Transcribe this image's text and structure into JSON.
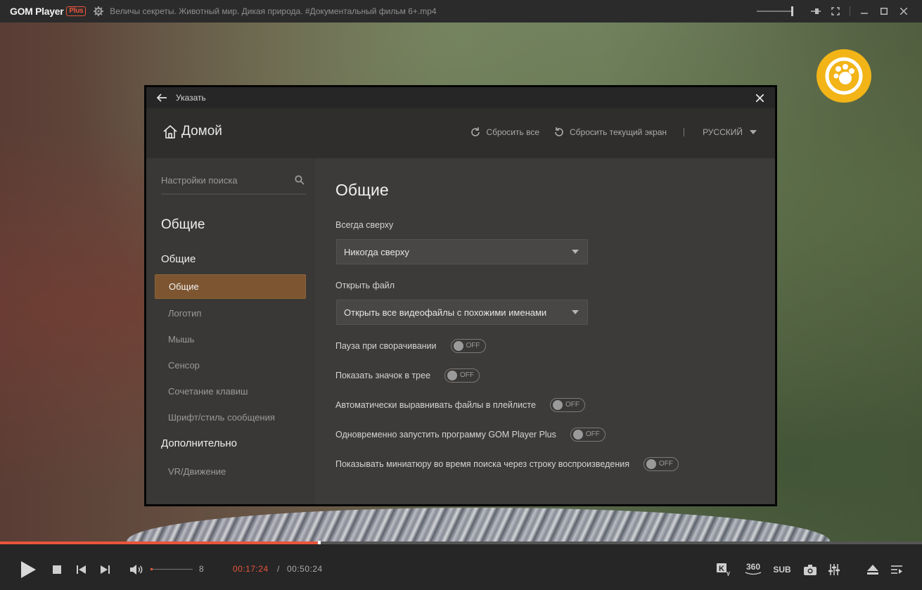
{
  "titlebar": {
    "app_name": "GOM Player",
    "app_badge": "Plus",
    "file_title": "Величы секреты. Животный мир. Дикая природа. #Документальный фильм 6+.mp4"
  },
  "dialog": {
    "header_title": "Указать",
    "home_label": "Домой",
    "reset_all": "Сбросить все",
    "reset_current": "Сбросить текущий экран",
    "language": "РУССКИЙ",
    "search_placeholder": "Настройки поиска",
    "sidebar": {
      "section_title": "Общие",
      "group1": "Общие",
      "items": [
        {
          "label": "Общие"
        },
        {
          "label": "Логотип"
        },
        {
          "label": "Мышь"
        },
        {
          "label": "Сенсор"
        },
        {
          "label": "Сочетание клавиш"
        },
        {
          "label": "Шрифт/стиль сообщения"
        }
      ],
      "group2": "Дополнительно",
      "group2_items": [
        {
          "label": "VR/Движение"
        }
      ]
    },
    "main": {
      "title": "Общие",
      "always_on_top_label": "Всегда сверху",
      "always_on_top_value": "Никогда сверху",
      "open_file_label": "Открыть файл",
      "open_file_value": "Открыть все видеофайлы с похожими именами",
      "toggles": [
        {
          "label": "Пауза при сворачивании",
          "state": "OFF"
        },
        {
          "label": "Показать значок в трее",
          "state": "OFF"
        },
        {
          "label": "Автоматически выравнивать файлы в плейлисте",
          "state": "OFF"
        },
        {
          "label": "Одновременно запустить программу GOM Player Plus",
          "state": "OFF"
        },
        {
          "label": "Показывать миниатюру во время поиска через строку воспроизведения",
          "state": "OFF"
        }
      ]
    }
  },
  "player": {
    "volume": "8",
    "time_current": "00:17:24",
    "time_separator": "/",
    "time_total": "00:50:24",
    "progress_fraction": 0.346,
    "label_360": "360",
    "label_sub": "SUB"
  },
  "colors": {
    "accent": "#e8553b",
    "active_item": "#7d5631",
    "brand_badge": "#f2b417"
  }
}
